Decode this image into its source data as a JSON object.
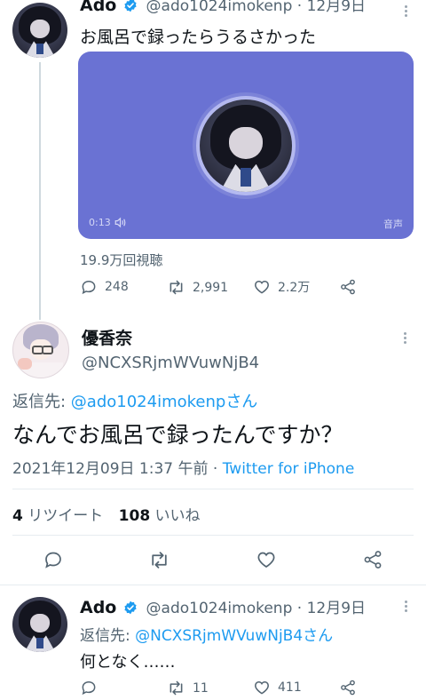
{
  "tweet1": {
    "name": "Ado",
    "handle_meta": "@ado1024imokenp · 12月9日",
    "text": "お風呂で録ったらうるさかった",
    "audio": {
      "time": "0:13",
      "label": "音声"
    },
    "views": "19.9万回視聴",
    "actions": {
      "replies": "248",
      "retweets": "2,991",
      "likes": "2.2万"
    }
  },
  "main_tweet": {
    "name": "優香奈",
    "handle": "@NCXSRjmWVuwNjB4",
    "reply_to_prefix": "返信先: ",
    "reply_to": "@ado1024imokenpさん",
    "text": "なんでお風呂で録ったんですか？",
    "timestamp": "2021年12月09日 1:37 午前",
    "separator": " · ",
    "source": "Twitter for iPhone",
    "retweet_count": "4",
    "retweet_label": " リツイート",
    "like_count": "108",
    "like_label": " いいね"
  },
  "reply_tweet": {
    "name": "Ado",
    "handle_meta": "@ado1024imokenp · 12月9日",
    "reply_to_prefix": "返信先: ",
    "reply_to": "@NCXSRjmWVuwNjB4さん",
    "text": "何となく……",
    "actions": {
      "replies": "",
      "retweets": "11",
      "likes": "411"
    }
  },
  "colors": {
    "accent": "#1d9bf0",
    "audio_card": "#6a72d3",
    "text": "#0f1419",
    "muted": "#536471"
  }
}
